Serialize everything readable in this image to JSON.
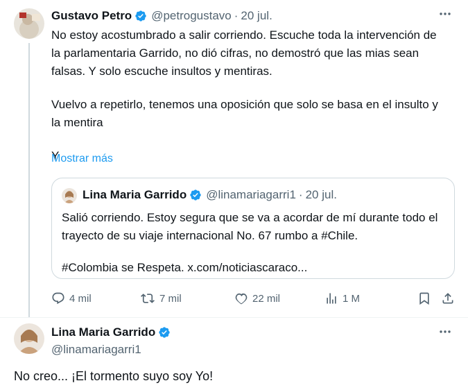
{
  "tweet": {
    "author_name": "Gustavo Petro",
    "handle": "@petrogustavo",
    "separator": "·",
    "date": "20 jul.",
    "text_lines": [
      "No estoy acostumbrado a salir corriendo. Escuche toda la intervención de",
      "la parlamentaria Garrido, no dió cifras, no demostró que las mias sean",
      "falsas. Y solo escuche insultos y mentiras.",
      "Vuelvo a repetirlo, tenemos una oposición que solo se basa en el insulto y",
      "la mentira",
      "Y"
    ],
    "show_more": "Mostrar más",
    "more_icon": "more-horizontal-icon",
    "quoted": {
      "author_name": "Lina Maria Garrido",
      "handle": "@linamariagarri1",
      "separator": "·",
      "date": "20 jul.",
      "text_lines": [
        "Salió corriendo. Estoy segura que se va a acordar de mí durante todo el",
        "trayecto de su viaje internacional No. 67 rumbo a #Chile.",
        "#Colombia se Respeta. x.com/noticiascaraco..."
      ]
    },
    "actions": {
      "replies": "4 mil",
      "retweets": "7 mil",
      "likes": "22 mil",
      "views": "1 M"
    }
  },
  "reply": {
    "author_name": "Lina Maria Garrido",
    "handle": "@linamariagarri1",
    "text": "No creo... ¡El tormento suyo soy Yo!",
    "more_icon": "more-horizontal-icon"
  },
  "colors": {
    "accent": "#1d9bf0",
    "muted": "#536471",
    "border": "#cfd9de",
    "thread_line": "#cfd9de"
  }
}
